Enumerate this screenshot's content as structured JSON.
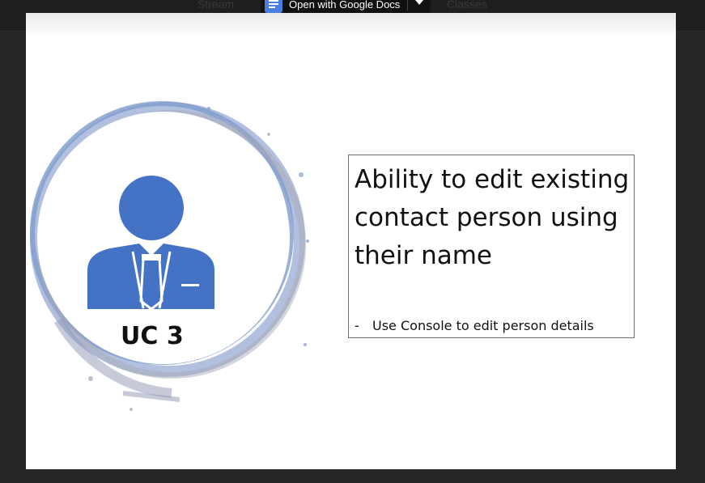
{
  "toolbar": {
    "open_with_label": "Open with Google Docs",
    "ghost_left": "Stream",
    "ghost_right": "Classes"
  },
  "slide": {
    "title": "Ability to edit existing contact person using their name",
    "bullet_marker": "-",
    "bullet": "Use Console to edit person details",
    "badge": "UC 3"
  },
  "colors": {
    "icon_blue": "#4472C4",
    "ring_blue": "#7f9ccc",
    "docs_blue": "#4a7fe0"
  }
}
